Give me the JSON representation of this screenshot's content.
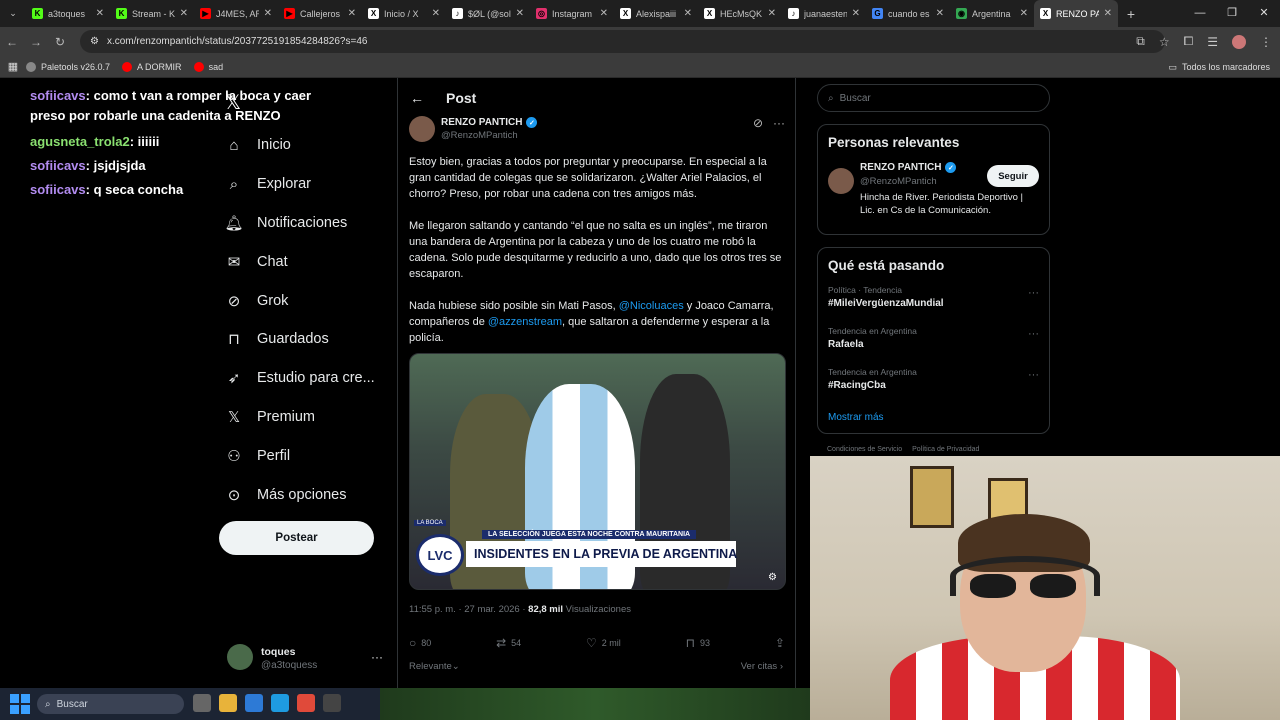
{
  "browser": {
    "tabs": [
      {
        "label": "a3toques",
        "icon_color": "#53fc18",
        "icon": "K"
      },
      {
        "label": "Stream - K",
        "icon_color": "#53fc18",
        "icon": "K"
      },
      {
        "label": "J4MES, AR",
        "icon_color": "#ff0000",
        "icon": "▶"
      },
      {
        "label": "Callejeros",
        "icon_color": "#ff0000",
        "icon": "▶"
      },
      {
        "label": "Inicio / X",
        "icon_color": "#ffffff",
        "icon": "X"
      },
      {
        "label": "$ØL (@sol",
        "icon_color": "#ffffff",
        "icon": "♪"
      },
      {
        "label": "Instagram",
        "icon_color": "#e1306c",
        "icon": "◎"
      },
      {
        "label": "Alexispaiii",
        "icon_color": "#ffffff",
        "icon": "X"
      },
      {
        "label": "HEcMsQK",
        "icon_color": "#ffffff",
        "icon": "X"
      },
      {
        "label": "juanaesten",
        "icon_color": "#ffffff",
        "icon": "♪"
      },
      {
        "label": "cuando es",
        "icon_color": "#4285f4",
        "icon": "G"
      },
      {
        "label": "Argentina",
        "icon_color": "#34a853",
        "icon": "◉"
      },
      {
        "label": "RENZO PA",
        "icon_color": "#ffffff",
        "icon": "X",
        "active": true
      }
    ],
    "url": "x.com/renzompantich/status/2037725191854284826?s=46",
    "bookmarks": [
      {
        "label": "Paletools v26.0.7",
        "color": "#888888"
      },
      {
        "label": "A DORMIR",
        "color": "#ff0000"
      },
      {
        "label": "sad",
        "color": "#ff0000"
      }
    ],
    "all_bookmarks": "Todos los marcadores"
  },
  "chat": [
    {
      "user": "sofiicavs",
      "text": ": como t van a romper la boca y caer preso por robarle una cadenita a RENZO",
      "color": "purple"
    },
    {
      "user": "agusneta_trola2",
      "text": ": iiiiii",
      "color": "green"
    },
    {
      "user": "sofiicavs",
      "text": ": jsjdjsjda",
      "color": "purple"
    },
    {
      "user": "sofiicavs",
      "text": ": q seca concha",
      "color": "purple"
    }
  ],
  "nav": {
    "items": [
      {
        "label": "Inicio",
        "icon": "home-icon"
      },
      {
        "label": "Explorar",
        "icon": "search-icon"
      },
      {
        "label": "Notificaciones",
        "icon": "bell-icon"
      },
      {
        "label": "Chat",
        "icon": "mail-icon"
      },
      {
        "label": "Grok",
        "icon": "grok-icon"
      },
      {
        "label": "Guardados",
        "icon": "bookmark-icon"
      },
      {
        "label": "Estudio para cre...",
        "icon": "rocket-icon"
      },
      {
        "label": "Premium",
        "icon": "x-icon"
      },
      {
        "label": "Perfil",
        "icon": "person-icon"
      },
      {
        "label": "Más opciones",
        "icon": "more-circle-icon"
      }
    ],
    "post_button": "Postear",
    "account": {
      "name": "toques",
      "handle": "@a3toquess"
    }
  },
  "post": {
    "header": "Post",
    "author": {
      "name": "RENZO PANTICH",
      "handle": "@RenzoMPantich"
    },
    "p1": "Estoy bien, gracias a todos por preguntar y preocuparse. En especial a la gran cantidad de colegas que se solidarizaron. ¿Walter Ariel Palacios, el chorro? Preso, por robar una cadena con tres amigos más.",
    "p2": "Me llegaron saltando y cantando “el que no salta es un inglés”, me tiraron una bandera de Argentina por la cabeza y uno de los cuatro me robó la cadena. Solo pude desquitarme y reducirlo a uno, dado que los otros tres se escaparon.",
    "p3_a": "Nada hubiese sido posible sin Mati Pasos, ",
    "p3_m1": "@Nicoluaces",
    "p3_b": " y Joaco Camarra, compañeros de ",
    "p3_m2": "@azzenstream",
    "p3_c": ", que saltaron a defenderme y esperar a la policía.",
    "media": {
      "tag": "LA BOCA",
      "kicker": "LA SELECCIÓN JUEGA ESTA NOCHE CONTRA MAURITANIA",
      "logo": "LVC",
      "headline": "INSIDENTES EN LA PREVIA DE ARGENTINA"
    },
    "time": "11:55 p. m. · 27 mar. 2026 · ",
    "views_num": "82,8 mil",
    "views_label": " Visualizaciones",
    "stats": {
      "replies": "80",
      "reposts": "54",
      "likes": "2 mil",
      "bookmarks": "93"
    },
    "relevant": "Relevante",
    "quotes": "Ver citas"
  },
  "sidebar": {
    "search_placeholder": "Buscar",
    "relevant_title": "Personas relevantes",
    "person": {
      "name": "RENZO PANTICH",
      "handle": "@RenzoMPantich",
      "bio": "Hincha de River. Periodista Deportivo | Lic. en Cs de la Comunicación.",
      "follow": "Seguir"
    },
    "trends_title": "Qué está pasando",
    "trends": [
      {
        "context": "Política · Tendencia",
        "topic": "#MileiVergüenzaMundial"
      },
      {
        "context": "Tendencia en Argentina",
        "topic": "Rafaela"
      },
      {
        "context": "Tendencia en Argentina",
        "topic": "#RacingCba"
      }
    ],
    "show_more": "Mostrar más",
    "legal": [
      "Condiciones de Servicio",
      "Política de Privacidad"
    ]
  },
  "taskbar": {
    "search": "Buscar"
  }
}
